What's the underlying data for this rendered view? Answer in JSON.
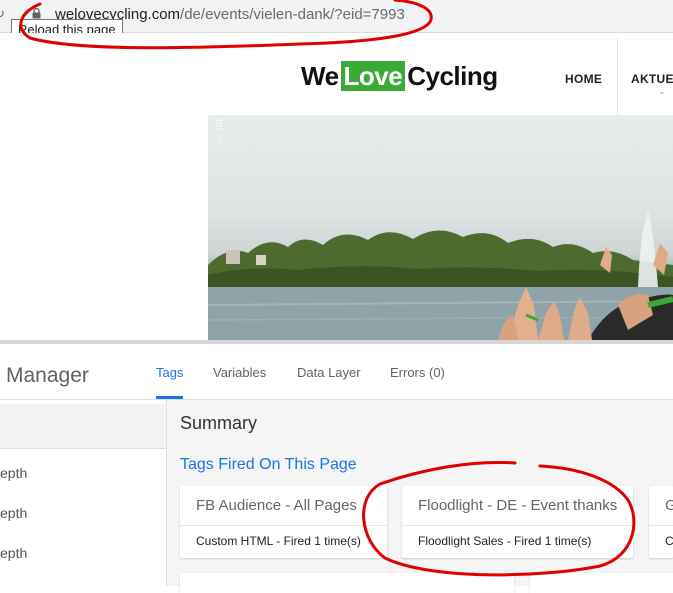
{
  "browser": {
    "url_domain": "welovecycling.com",
    "url_path": "/de/events/vielen-dank/?eid=7993",
    "tooltip": "Reload this page"
  },
  "site": {
    "logo_left": "We",
    "logo_love": "Love",
    "logo_right": "Cycling",
    "nav": [
      "HOME",
      "AKTUEL"
    ],
    "hero_copyright": "© lar",
    "brand_green": "#3aa935"
  },
  "gtm": {
    "title": "Manager",
    "tabs": [
      {
        "label": "Tags",
        "active": true
      },
      {
        "label": "Variables",
        "active": false
      },
      {
        "label": "Data Layer",
        "active": false
      },
      {
        "label": "Errors (0)",
        "active": false
      }
    ],
    "sidebar_items": [
      "epth",
      "epth",
      "epth"
    ],
    "summary_title": "Summary",
    "fired_heading": "Tags Fired On This Page",
    "cards": [
      {
        "name": "FB Audience - All Pages",
        "status": "Custom HTML - Fired 1 time(s)"
      },
      {
        "name": "Floodlight - DE - Event thanks",
        "status": "Floodlight Sales - Fired 1 time(s)"
      },
      {
        "name": "G",
        "status": "C"
      }
    ],
    "accent_color": "#1a73e8"
  },
  "annotation_color": "#e00000"
}
